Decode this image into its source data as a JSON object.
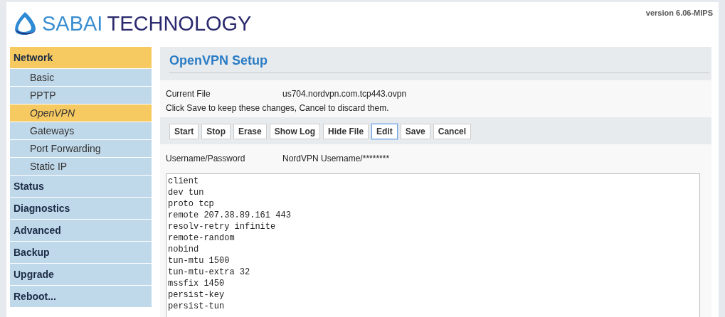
{
  "header": {
    "logo_part_1": "SABAI",
    "logo_part_2": "TECHNOLOGY",
    "version": "version 6.06-MIPS"
  },
  "sidebar": {
    "items": [
      {
        "label": "Network",
        "selected": true,
        "children": [
          {
            "label": "Basic",
            "selected": false
          },
          {
            "label": "PPTP",
            "selected": false
          },
          {
            "label": "OpenVPN",
            "selected": true
          },
          {
            "label": "Gateways",
            "selected": false
          },
          {
            "label": "Port Forwarding",
            "selected": false
          },
          {
            "label": "Static IP",
            "selected": false
          }
        ]
      },
      {
        "label": "Status",
        "selected": false
      },
      {
        "label": "Diagnostics",
        "selected": false
      },
      {
        "label": "Advanced",
        "selected": false
      },
      {
        "label": "Backup",
        "selected": false
      },
      {
        "label": "Upgrade",
        "selected": false
      },
      {
        "label": "Reboot...",
        "selected": false
      }
    ]
  },
  "main": {
    "title": "OpenVPN Setup",
    "file_label": "Current File",
    "file_value": "us704.nordvpn.com.tcp443.ovpn",
    "notice": "Click Save to keep these changes, Cancel to discard them.",
    "buttons": [
      {
        "label": "Start",
        "selected": false
      },
      {
        "label": "Stop",
        "selected": false
      },
      {
        "label": "Erase",
        "selected": false
      },
      {
        "label": "Show Log",
        "selected": false
      },
      {
        "label": "Hide File",
        "selected": false
      },
      {
        "label": "Edit",
        "selected": true
      },
      {
        "label": "Save",
        "selected": false
      },
      {
        "label": "Cancel",
        "selected": false
      }
    ],
    "credentials_label": "Username/Password",
    "credentials_value": "NordVPN Username/********",
    "config_lines": [
      "client",
      "dev tun",
      "proto tcp",
      "remote 207.38.89.161 443",
      "resolv-retry infinite",
      "remote-random",
      "nobind",
      "tun-mtu 1500",
      "tun-mtu-extra 32",
      "mssfix 1450",
      "persist-key",
      "persist-tun"
    ]
  }
}
